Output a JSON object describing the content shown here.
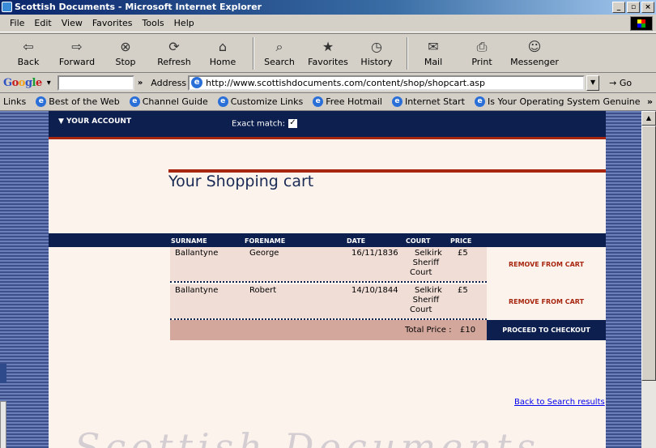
{
  "window": {
    "title": "Scottish Documents - Microsoft Internet Explorer"
  },
  "menubar": {
    "items": [
      "File",
      "Edit",
      "View",
      "Favorites",
      "Tools",
      "Help"
    ]
  },
  "toolbar": {
    "buttons": [
      {
        "label": "Back",
        "icon": "back-arrow-icon",
        "glyph": "⇦"
      },
      {
        "label": "Forward",
        "icon": "forward-arrow-icon",
        "glyph": "⇨"
      },
      {
        "label": "Stop",
        "icon": "stop-icon",
        "glyph": "⊗"
      },
      {
        "label": "Refresh",
        "icon": "refresh-icon",
        "glyph": "⟳"
      },
      {
        "label": "Home",
        "icon": "home-icon",
        "glyph": "⌂"
      },
      {
        "label": "Search",
        "icon": "search-icon",
        "glyph": "⌕"
      },
      {
        "label": "Favorites",
        "icon": "favorites-icon",
        "glyph": "★"
      },
      {
        "label": "History",
        "icon": "history-icon",
        "glyph": "◷"
      },
      {
        "label": "Mail",
        "icon": "mail-icon",
        "glyph": "✉"
      },
      {
        "label": "Print",
        "icon": "print-icon",
        "glyph": "⎙"
      },
      {
        "label": "Messenger",
        "icon": "messenger-icon",
        "glyph": "☺"
      }
    ]
  },
  "google": {
    "logo": "Google"
  },
  "address": {
    "label": "Address",
    "url": "http://www.scottishdocuments.com/content/shop/shopcart.asp",
    "go": "Go"
  },
  "links": {
    "label": "Links",
    "items": [
      "Best of the Web",
      "Channel Guide",
      "Customize Links",
      "Free Hotmail",
      "Internet Start",
      "Is Your Operating System Genuine"
    ]
  },
  "site": {
    "account": "▼ YOUR ACCOUNT",
    "exact_match": "Exact match:",
    "exact_checked": "✓",
    "heading": "Your Shopping cart",
    "columns": [
      "SURNAME",
      "FORENAME",
      "DATE",
      "COURT",
      "PRICE"
    ],
    "rows": [
      {
        "surname": "Ballantyne",
        "forename": "George",
        "date": "16/11/1836",
        "court": [
          "Selkirk",
          "Sheriff",
          "Court"
        ],
        "price": "£5",
        "action": "REMOVE FROM CART"
      },
      {
        "surname": "Ballantyne",
        "forename": "Robert",
        "date": "14/10/1844",
        "court": [
          "Selkirk",
          "Sheriff",
          "Court"
        ],
        "price": "£5",
        "action": "REMOVE FROM CART"
      }
    ],
    "total_label": "Total Price :",
    "total_value": "£10",
    "checkout": "PROCEED TO CHECKOUT",
    "back_link": "Back to Search results",
    "watermark": "Scottish Documents"
  },
  "colors": {
    "navy": "#0c1f4e",
    "red": "#a8260f",
    "row_bg": "#f0ddd6",
    "total_bg": "#d4a79c"
  }
}
